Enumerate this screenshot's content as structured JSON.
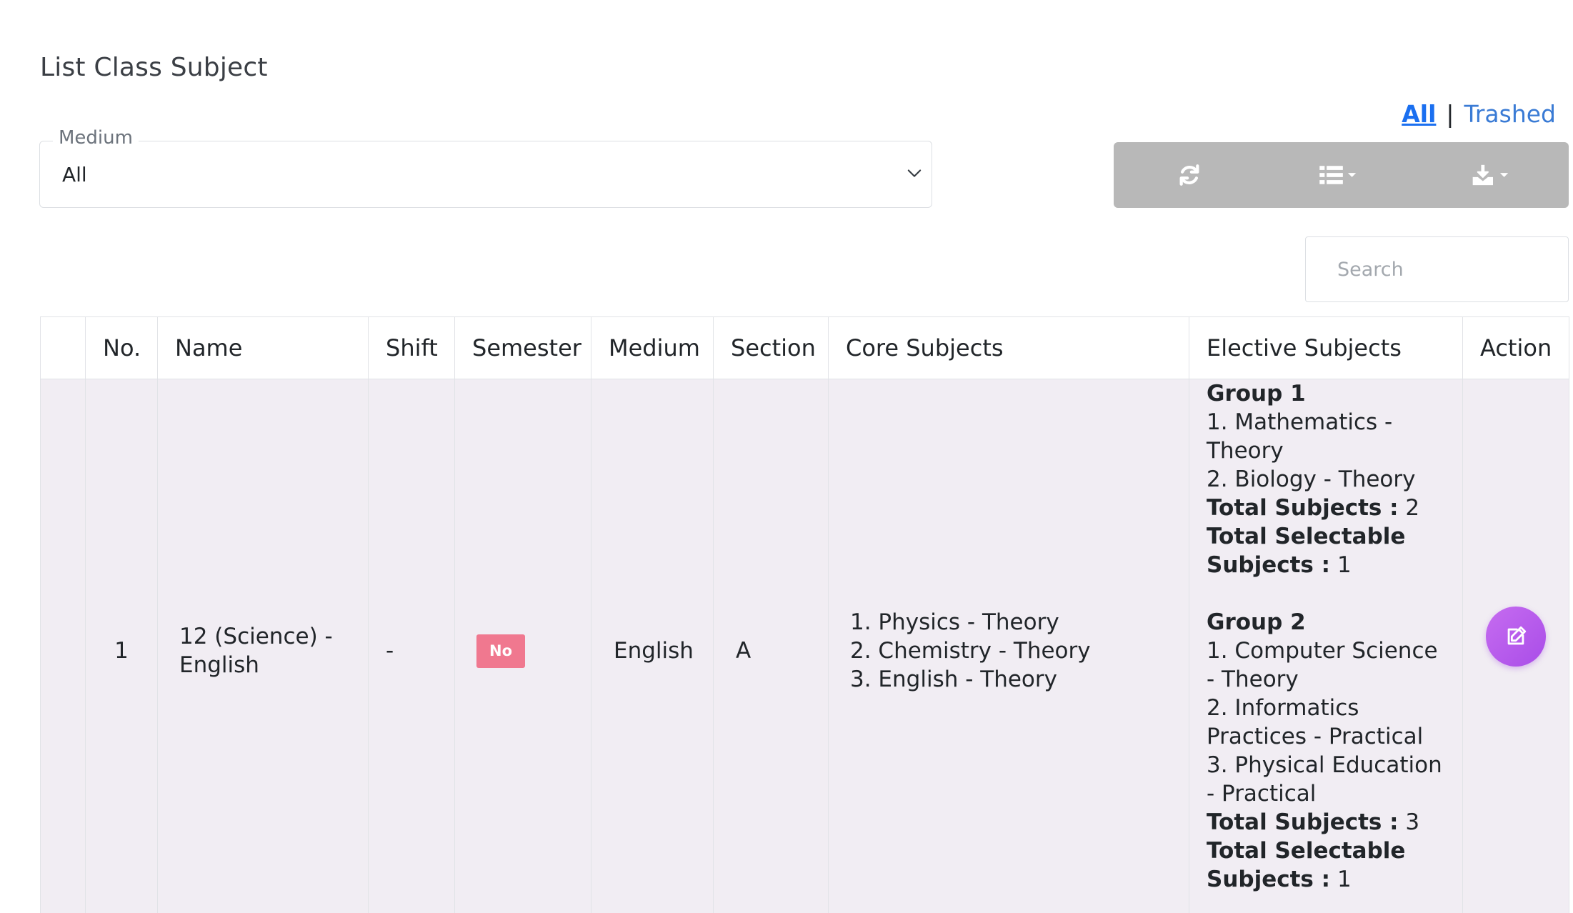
{
  "page": {
    "title": "List Class Subject"
  },
  "view_links": {
    "all": "All",
    "separator": "|",
    "trashed": "Trashed"
  },
  "filter": {
    "label": "Medium",
    "value": "All"
  },
  "toolbar": {
    "buttons": [
      {
        "icon": "refresh-icon"
      },
      {
        "icon": "columns-list-icon",
        "dropdown": true
      },
      {
        "icon": "download-icon",
        "dropdown": true
      }
    ],
    "color": "#b8b8b8"
  },
  "search": {
    "placeholder": "Search"
  },
  "table": {
    "columns": [
      "No.",
      "Name",
      "Shift",
      "Semester",
      "Medium",
      "Section",
      "Core Subjects",
      "Elective Subjects",
      "Action"
    ],
    "rows": [
      {
        "no": "1",
        "name": "12 (Science) - English",
        "shift": "-",
        "semester": "No",
        "medium": "English",
        "section": "A",
        "core_subjects": [
          "1. Physics - Theory",
          "2. Chemistry - Theory",
          "3. English - Theory"
        ],
        "elective_groups": [
          {
            "title": "Group 1",
            "subjects": [
              "1. Mathematics - Theory",
              "2. Biology - Theory"
            ],
            "total_label": "Total Subjects :",
            "total_value": "2",
            "selectable_label": "Total Selectable Subjects :",
            "selectable_value": "1"
          },
          {
            "title": "Group 2",
            "subjects": [
              "1. Computer Science - Theory",
              "2. Informatics Practices - Practical",
              "3. Physical Education - Practical"
            ],
            "total_label": "Total Subjects :",
            "total_value": "3",
            "selectable_label": "Total Selectable Subjects :",
            "selectable_value": "1"
          }
        ]
      }
    ]
  },
  "colors": {
    "row_background": "#f1edf3",
    "badge": "#f0788f",
    "edit_button": "#b65eec",
    "link": "#1a6ff0"
  }
}
